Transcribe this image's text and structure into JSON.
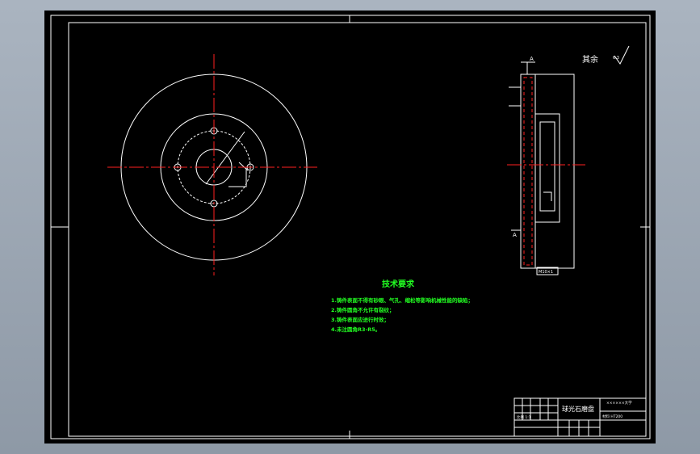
{
  "roughness_note": {
    "label": "其余",
    "symbol_value": "6.3"
  },
  "section": {
    "label_top": "A",
    "label_bottom": "A",
    "dim_note": "M10×1"
  },
  "notes": {
    "title": "技术要求",
    "lines": [
      "1.铸件表面不得有砂眼、气孔、缩松等影响机械性能的缺陷；",
      "2.铸件圆角不允许有裂纹；",
      "3.铸件表面应进行时效；",
      "4.未注圆角R3-R5。"
    ]
  },
  "title_block": {
    "part_name": "球光石磨盘",
    "company": "××××××大学",
    "drawing_no": "材料 HT200",
    "material_note": "比例 1:1"
  },
  "colors": {
    "background": "#000000",
    "line": "#ffffff",
    "center": "#ff2020",
    "notes": "#22ff22"
  }
}
